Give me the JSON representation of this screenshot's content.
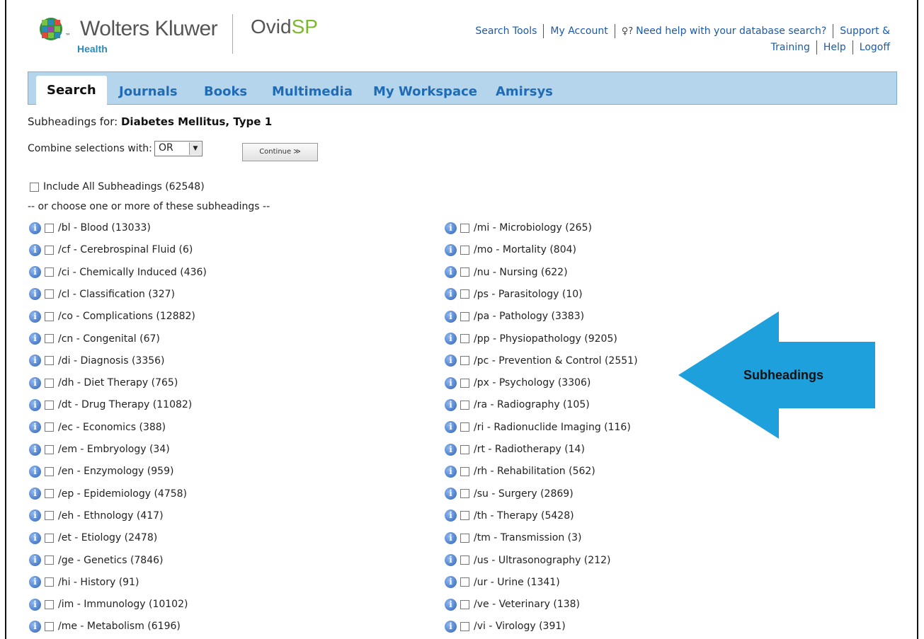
{
  "header": {
    "brand_name": "Wolters Kluwer",
    "brand_sub": "Health",
    "product_prefix": "Ovid",
    "product_suffix": "SP",
    "links_row1": [
      "Search Tools",
      "My Account",
      "Need help with your database search?",
      "Support &"
    ],
    "links_row2": [
      "Training",
      "Help",
      "Logoff"
    ]
  },
  "nav": {
    "tabs": [
      "Search",
      "Journals",
      "Books",
      "Multimedia",
      "My Workspace",
      "Amirsys"
    ],
    "active": "Search"
  },
  "subheadings": {
    "title_prefix": "Subheadings for:",
    "term": "Diabetes Mellitus, Type 1",
    "combine_label": "Combine selections with:",
    "combine_value": "OR",
    "continue_label": "Continue ≫",
    "include_all_label": "Include All Subheadings (62548)",
    "choose_hint": "-- or choose one or more of these subheadings --",
    "left_column": [
      "/bl - Blood (13033)",
      "/cf - Cerebrospinal Fluid (6)",
      "/ci - Chemically Induced (436)",
      "/cl - Classification (327)",
      "/co - Complications (12882)",
      "/cn - Congenital (67)",
      "/di - Diagnosis (3356)",
      "/dh - Diet Therapy (765)",
      "/dt - Drug Therapy (11082)",
      "/ec - Economics (388)",
      "/em - Embryology (34)",
      "/en - Enzymology (959)",
      "/ep - Epidemiology (4758)",
      "/eh - Ethnology (417)",
      "/et - Etiology (2478)",
      "/ge - Genetics (7846)",
      "/hi - History (91)",
      "/im - Immunology (10102)",
      "/me - Metabolism (6196)"
    ],
    "right_column": [
      "/mi - Microbiology (265)",
      "/mo - Mortality (804)",
      "/nu - Nursing (622)",
      "/ps - Parasitology (10)",
      "/pa - Pathology (3383)",
      "/pp - Physiopathology (9205)",
      "/pc - Prevention & Control (2551)",
      "/px - Psychology (3306)",
      "/ra - Radiography (105)",
      "/ri - Radionuclide Imaging (116)",
      "/rt - Radiotherapy (14)",
      "/rh - Rehabilitation (562)",
      "/su - Surgery (2869)",
      "/th - Therapy (5428)",
      "/tm - Transmission (3)",
      "/us - Ultrasonography (212)",
      "/ur - Urine (1341)",
      "/ve - Veterinary (138)",
      "/vi - Virology (391)"
    ]
  },
  "callout": {
    "label": "Subheadings",
    "color": "#1ea0dc"
  },
  "icons": {
    "info": "info-icon",
    "help": "help-icon",
    "dropdown": "chevron-down-icon",
    "logo": "wolters-kluwer-logo"
  }
}
